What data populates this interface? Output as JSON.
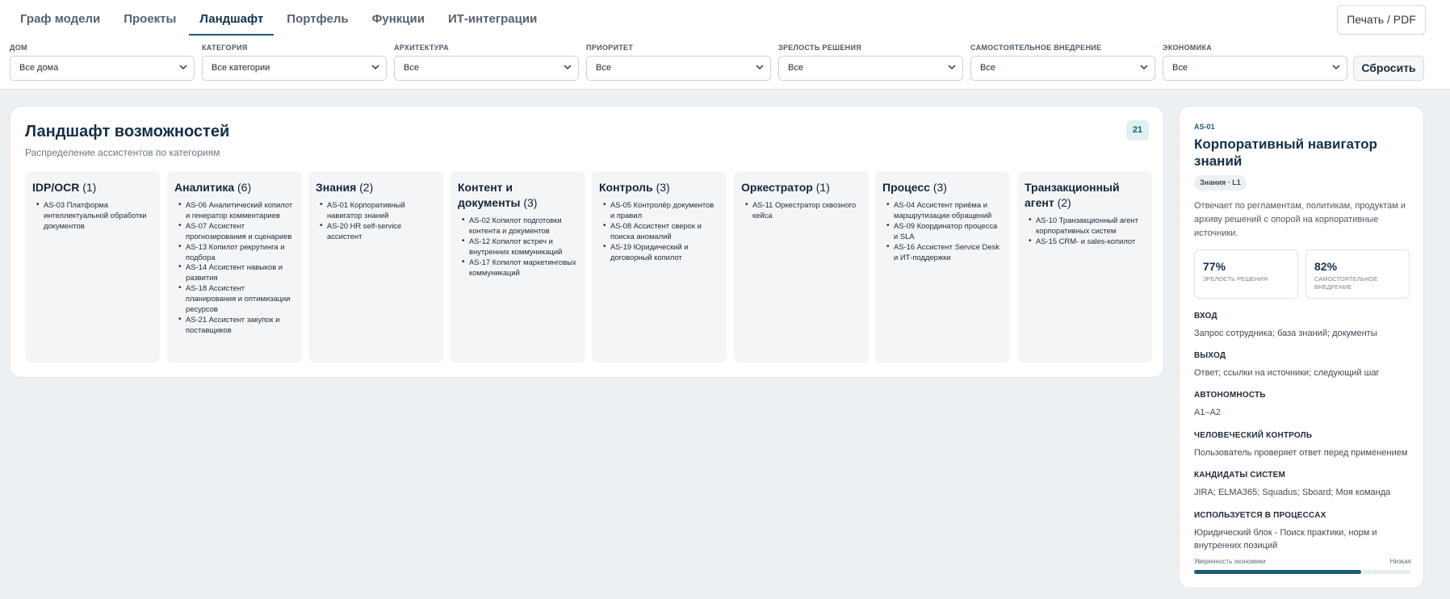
{
  "tabs": [
    "Граф модели",
    "Проекты",
    "Ландшафт",
    "Портфель",
    "Функции",
    "ИТ-интеграции"
  ],
  "active_tab": "Ландшафт",
  "print_label": "Печать / PDF",
  "filters": [
    {
      "label": "Дом",
      "value": "Все дома"
    },
    {
      "label": "Категория",
      "value": "Все категории"
    },
    {
      "label": "Архитектура",
      "value": "Все"
    },
    {
      "label": "Приоритет",
      "value": "Все"
    },
    {
      "label": "Зрелость решения",
      "value": "Все"
    },
    {
      "label": "Самостоятельное внедрение",
      "value": "Все"
    },
    {
      "label": "Экономика",
      "value": "Все"
    }
  ],
  "reset_label": "Сбросить",
  "landscape": {
    "title": "Ландшафт возможностей",
    "subtitle": "Распределение ассистентов по категориям",
    "count": "21",
    "categories": [
      {
        "name": "IDP/OCR",
        "count": "(1)",
        "items": [
          "AS-03 Платформа интеллектуальной обработки документов"
        ]
      },
      {
        "name": "Аналитика",
        "count": "(6)",
        "items": [
          "AS-06 Аналитический копилот и генератор комментариев",
          "AS-07 Ассистент прогнозирования и сценариев",
          "AS-13 Копилот рекрутинга и подбора",
          "AS-14 Ассистент навыков и развития",
          "AS-18 Ассистент планирования и оптимизации ресурсов",
          "AS-21 Ассистент закупок и поставщиков"
        ]
      },
      {
        "name": "Знания",
        "count": "(2)",
        "items": [
          "AS-01 Корпоративный навигатор знаний",
          "AS-20 HR self-service ассистент"
        ]
      },
      {
        "name": "Контент и документы",
        "count": "(3)",
        "items": [
          "AS-02 Копилот подготовки контента и документов",
          "AS-12 Копилот встреч и внутренних коммуникаций",
          "AS-17 Копилот маркетинговых коммуникаций"
        ]
      },
      {
        "name": "Контроль",
        "count": "(3)",
        "items": [
          "AS-05 Контролёр документов и правил",
          "AS-08 Ассистент сверок и поиска аномалий",
          "AS-19 Юридический и договорный копилот"
        ]
      },
      {
        "name": "Оркестратор",
        "count": "(1)",
        "items": [
          "AS-11 Оркестратор сквозного кейса"
        ]
      },
      {
        "name": "Процесс",
        "count": "(3)",
        "items": [
          "AS-04 Ассистент приёма и маршрутизации обращений",
          "AS-09 Координатор процесса и SLA",
          "AS-16 Ассистент Service Desk и ИТ-поддержки"
        ]
      },
      {
        "name": "Транзакционный агент",
        "count": "(2)",
        "items": [
          "AS-10 Транзакционный агент корпоративных систем",
          "AS-15 CRM- и sales-копилот"
        ]
      }
    ]
  },
  "detail": {
    "code": "AS-01",
    "title": "Корпоративный навигатор знаний",
    "tag": "Знания · L1",
    "description": "Отвечает по регламентам, политикам, продуктам и архиву решений с опорой на корпоративные источники.",
    "metrics": [
      {
        "value": "77%",
        "label": "Зрелость решения"
      },
      {
        "value": "82%",
        "label": "Самостоятельное внедрение"
      }
    ],
    "sections": [
      {
        "heading": "Вход",
        "value": "Запрос сотрудника; база знаний; документы"
      },
      {
        "heading": "Выход",
        "value": "Ответ; ссылки на источники; следующий шаг"
      },
      {
        "heading": "Автономность",
        "value": "A1–A2"
      },
      {
        "heading": "Человеческий контроль",
        "value": "Пользователь проверяет ответ перед применением"
      },
      {
        "heading": "Кандидаты систем",
        "value": "JIRA; ELMA365; Squadus; Sboard; Моя команда"
      },
      {
        "heading": "Используется в процессах",
        "value": "Юридический блок - Поиск практики, норм и внутренних позиций"
      }
    ],
    "confidence_label": "Уверенность экономики",
    "confidence_value": "Низкая",
    "confidence_fill": 0.77,
    "accent": "#1d5d77"
  }
}
